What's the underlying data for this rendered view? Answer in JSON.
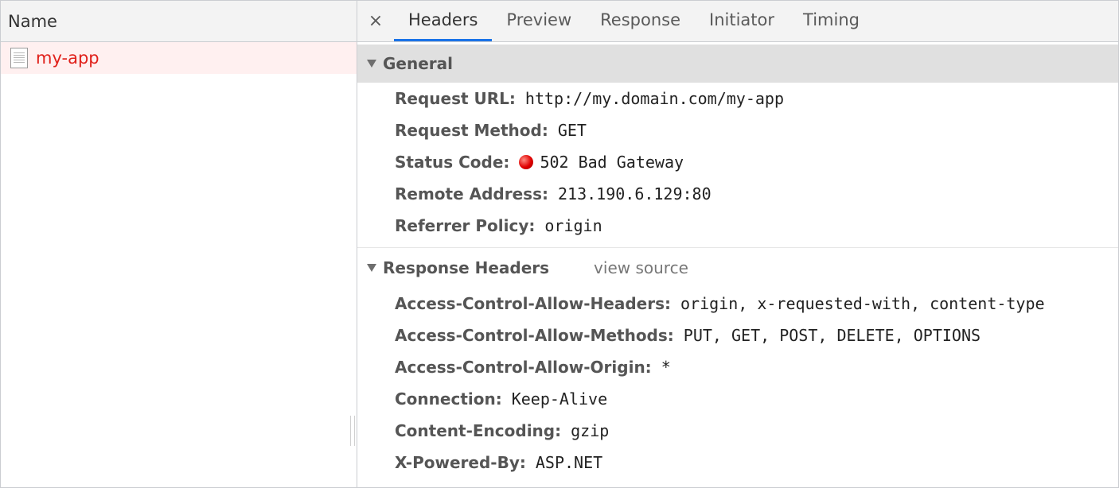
{
  "left": {
    "header": "Name",
    "request_name": "my-app"
  },
  "tabs": [
    "Headers",
    "Preview",
    "Response",
    "Initiator",
    "Timing"
  ],
  "active_tab": "Headers",
  "close_symbol": "×",
  "general": {
    "title": "General",
    "rows": [
      {
        "key": "Request URL:",
        "value": "http://my.domain.com/my-app"
      },
      {
        "key": "Request Method:",
        "value": "GET"
      },
      {
        "key": "Status Code:",
        "value": "502 Bad Gateway"
      },
      {
        "key": "Remote Address:",
        "value": "213.190.6.129:80"
      },
      {
        "key": "Referrer Policy:",
        "value": "origin"
      }
    ]
  },
  "response_headers": {
    "title": "Response Headers",
    "view_source": "view source",
    "rows": [
      {
        "key": "Access-Control-Allow-Headers:",
        "value": "origin, x-requested-with, content-type"
      },
      {
        "key": "Access-Control-Allow-Methods:",
        "value": "PUT, GET, POST, DELETE, OPTIONS"
      },
      {
        "key": "Access-Control-Allow-Origin:",
        "value": "*"
      },
      {
        "key": "Connection:",
        "value": "Keep-Alive"
      },
      {
        "key": "Content-Encoding:",
        "value": "gzip"
      },
      {
        "key": "X-Powered-By:",
        "value": "ASP.NET"
      }
    ]
  },
  "colors": {
    "accent": "#1a73e8",
    "error_text": "#e0201a",
    "error_row_bg": "#fff0f0",
    "status_dot": "#e00000"
  }
}
